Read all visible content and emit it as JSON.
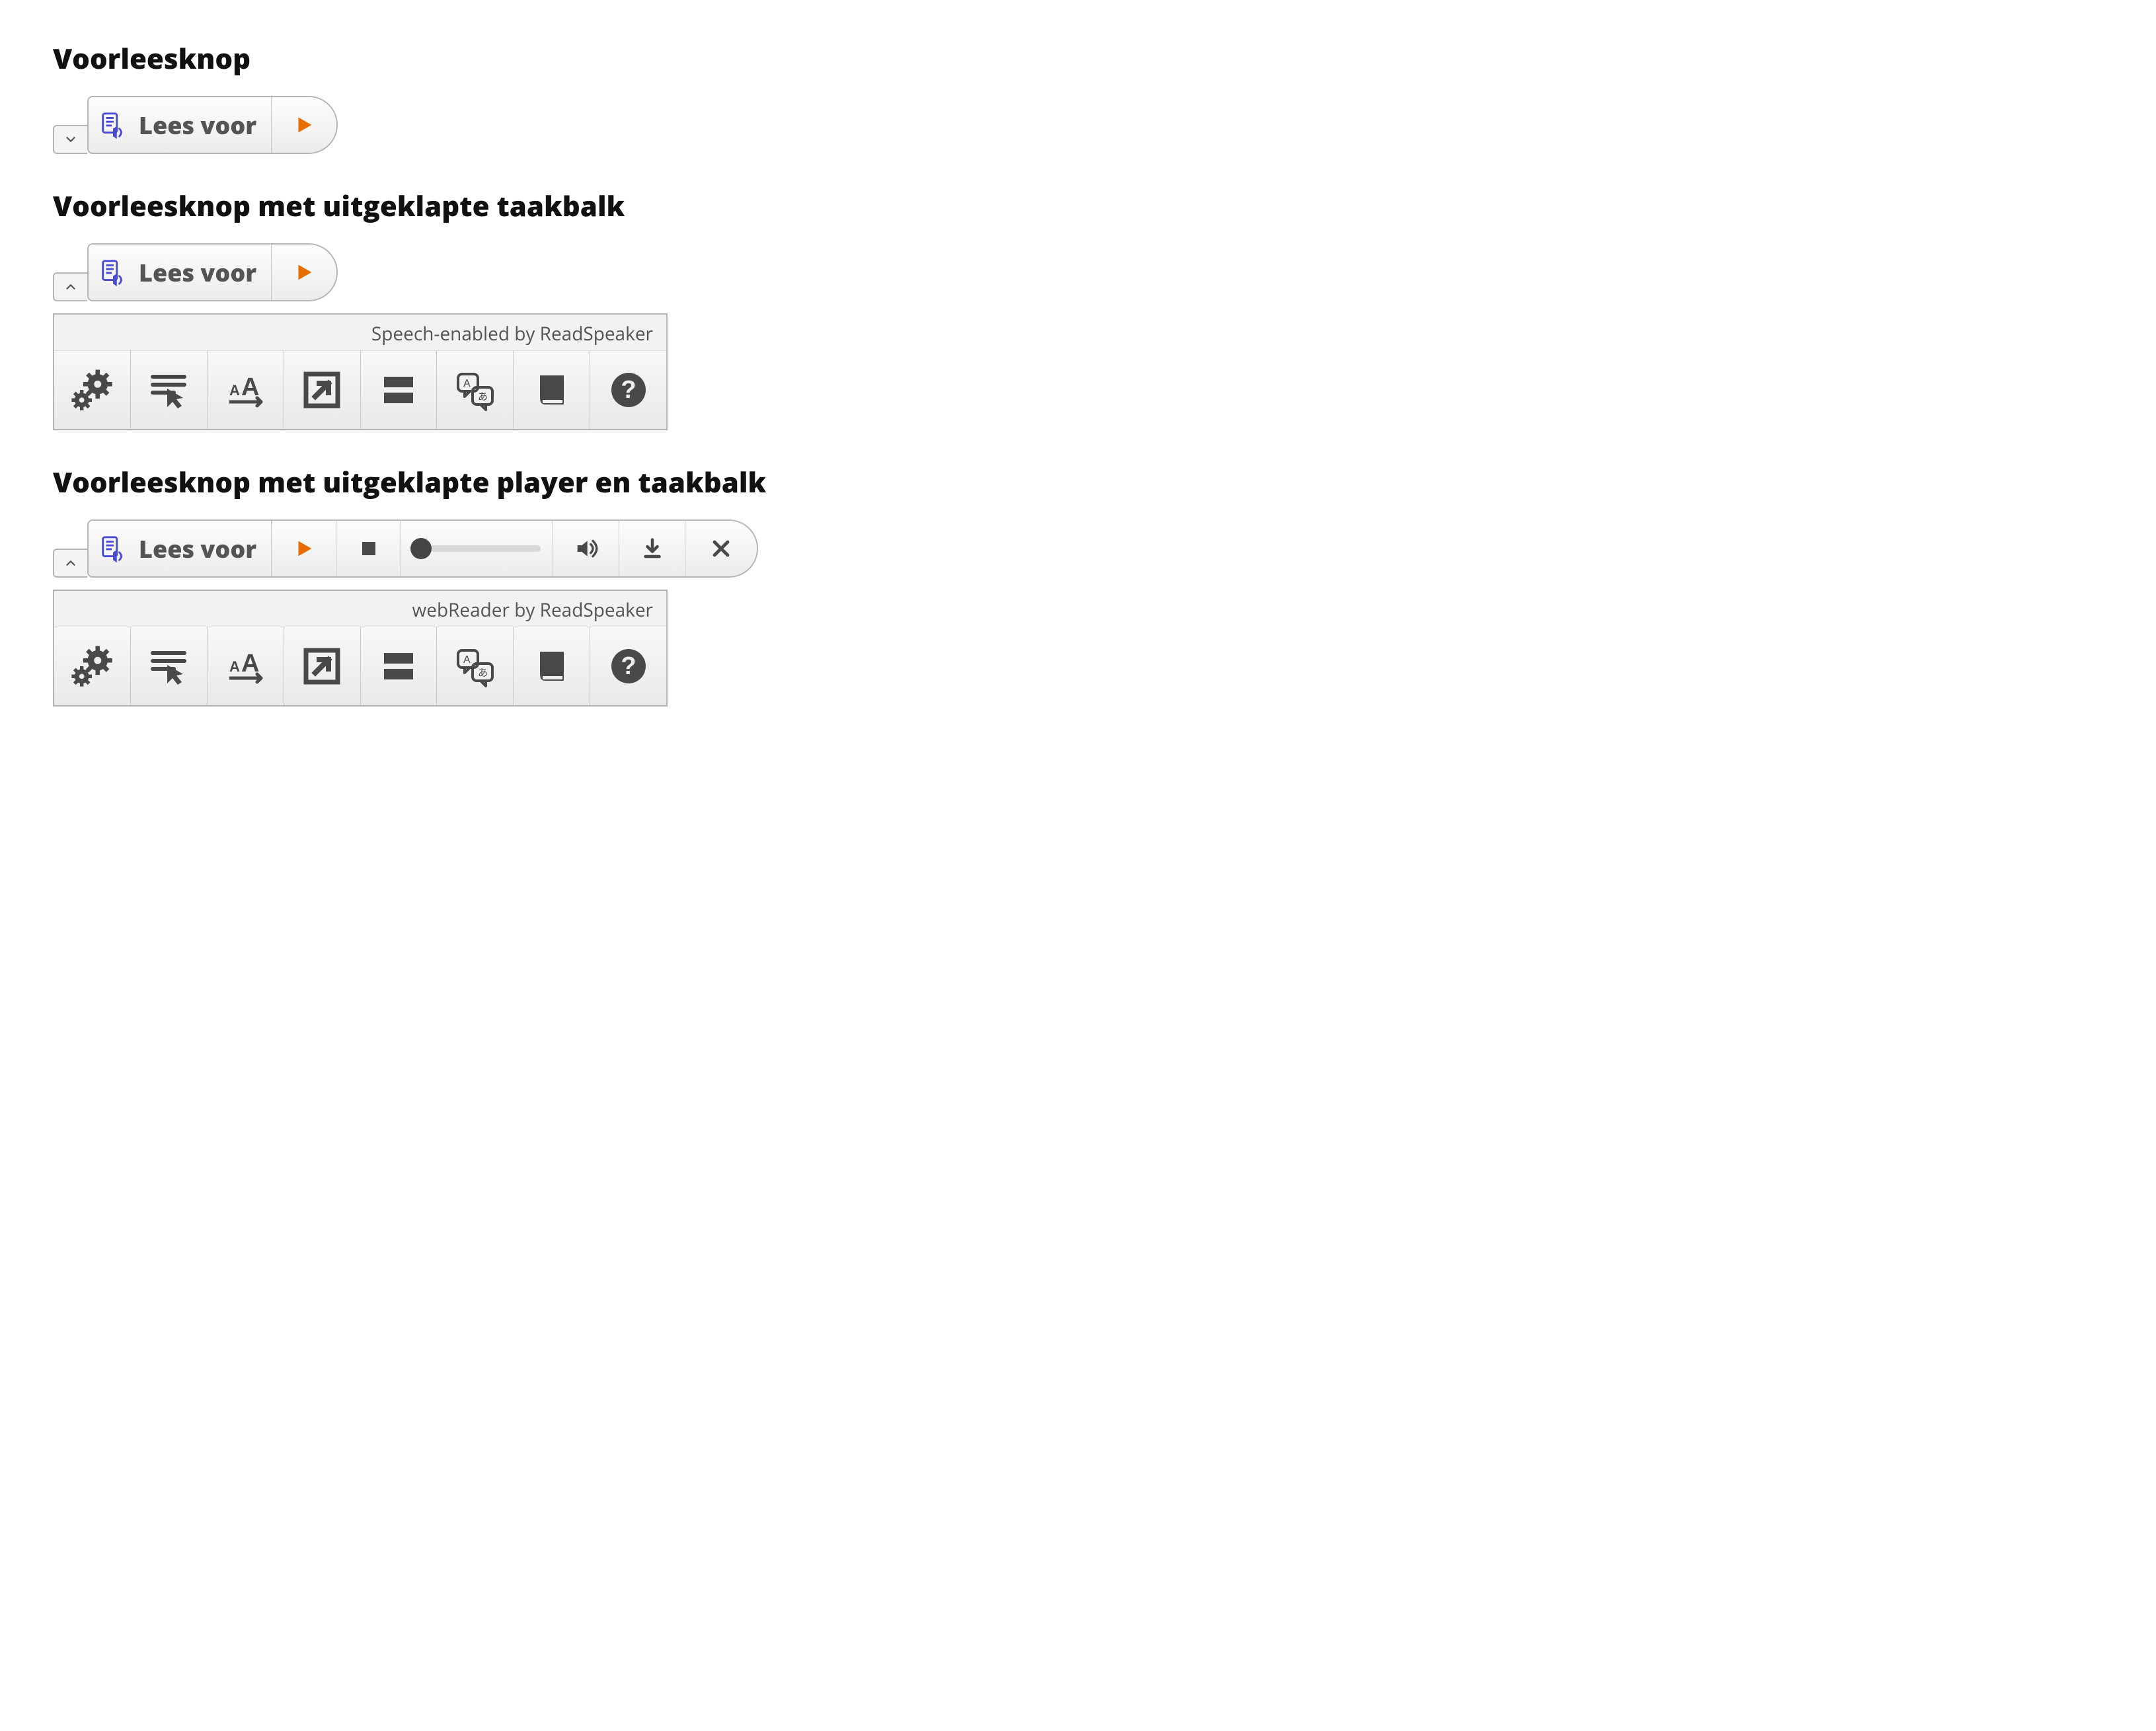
{
  "sections": {
    "s1_title": "Voorleesknop",
    "s2_title": "Voorleesknop met uitgeklapte taakbalk",
    "s3_title": "Voorleesknop met uitgeklapte player en taakbalk"
  },
  "button": {
    "label": "Lees voor"
  },
  "toolbar": {
    "caption_short": "Speech-enabled by ReadSpeaker",
    "caption_full": "webReader by ReadSpeaker",
    "tools": {
      "settings": "settings",
      "click_read": "click-and-read",
      "textsize": "text-size",
      "popout": "open-new-window",
      "pagemask": "page-mask",
      "translate": "translate",
      "dictionary": "dictionary",
      "help": "help"
    }
  },
  "player": {
    "play": "play",
    "stop": "stop",
    "volume": "volume",
    "download": "download",
    "close": "close",
    "position_percent": 0
  }
}
